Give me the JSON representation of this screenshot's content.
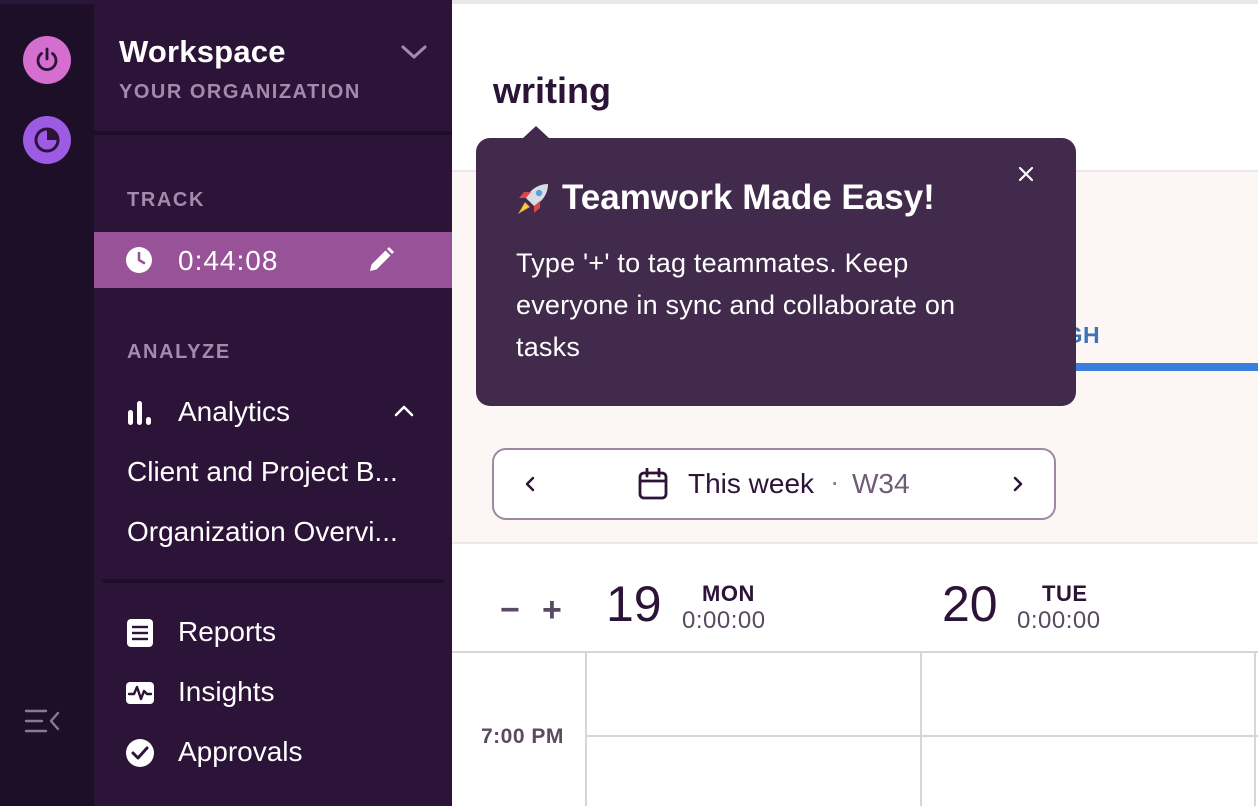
{
  "sidebar": {
    "workspace_title": "Workspace",
    "workspace_subtitle": "YOUR ORGANIZATION",
    "track_section": "TRACK",
    "timer": "0:44:08",
    "analyze_section": "ANALYZE",
    "analytics_label": "Analytics",
    "analytics_sub": [
      "Client and Project B...",
      "Organization Overvi..."
    ],
    "reports_label": "Reports",
    "insights_label": "Insights",
    "approvals_label": "Approvals"
  },
  "main": {
    "entry_title": "writing",
    "tab_partial": "ROUGH",
    "week_picker": {
      "label": "This week",
      "separator": "·",
      "week": "W34"
    },
    "zoom_out": "−",
    "zoom_in": "+",
    "days": [
      {
        "num": "19",
        "name": "MON",
        "duration": "0:00:00"
      },
      {
        "num": "20",
        "name": "TUE",
        "duration": "0:00:00"
      }
    ],
    "time_label": "7:00 PM"
  },
  "tooltip": {
    "emoji": "rocket-icon",
    "title": "Teamwork Made Easy!",
    "body": "Type '+' to tag teammates. Keep everyone in sync and collaborate on tasks"
  },
  "colors": {
    "rail": "#1e0f28",
    "sidebar": "#2c1338",
    "timer_row": "#985297",
    "power": "#d46fd0",
    "tracker": "#9d5ae2",
    "tooltip": "#412a4c",
    "tab_accent": "#3a7ee0"
  }
}
